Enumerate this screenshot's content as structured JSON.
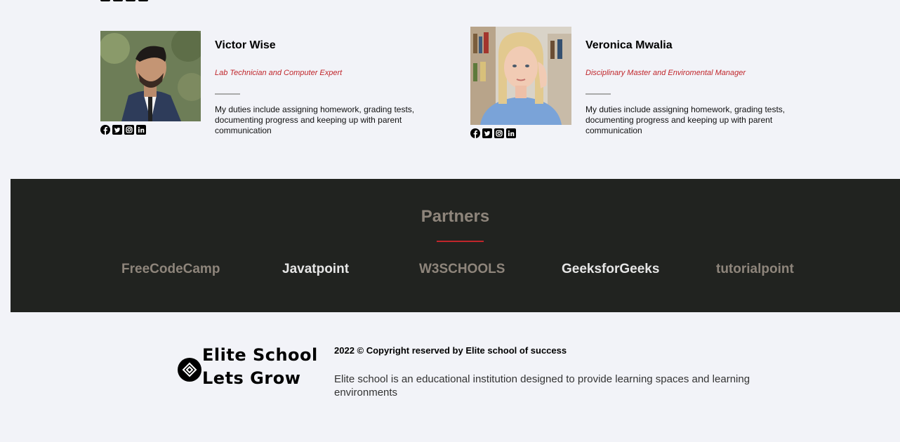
{
  "members": [
    {
      "name": "Victor Wise",
      "role": "Lab Technician and Computer Expert",
      "bio": "My duties include assigning homework, grading tests, documenting progress and keeping up with parent communication",
      "photo": "victor-photo",
      "socials": [
        "facebook-icon",
        "twitter-icon",
        "instagram-icon",
        "linkedin-icon"
      ]
    },
    {
      "name": "Veronica Mwalia",
      "role": "Disciplinary Master and Enviromental Manager",
      "bio": "My duties include assigning homework, grading tests, documenting progress and keeping up with parent communication",
      "photo": "veronica-photo",
      "socials": [
        "facebook-icon",
        "twitter-icon",
        "instagram-icon",
        "linkedin-icon"
      ]
    }
  ],
  "partners": {
    "title": "Partners",
    "links": [
      {
        "label": "FreeCodeCamp",
        "color": "#8e857b"
      },
      {
        "label": "Javatpoint",
        "color": "#e6e6e6"
      },
      {
        "label": "W3SCHOOLS",
        "color": "#8e857b"
      },
      {
        "label": "GeeksforGeeks",
        "color": "#e6e6e6"
      },
      {
        "label": "tutorialpoint",
        "color": "#8e857b"
      }
    ]
  },
  "footer": {
    "logo_line1": "Elite School",
    "logo_line2": "Lets Grow",
    "copyright": "2022 © Copyright reserved by Elite school of success",
    "description": "Elite school is an educational institution designed to provide learning spaces and learning environments"
  },
  "colors": {
    "accent": "#c0262b",
    "partners_bg": "#212320",
    "page_bg": "#f2f3f8"
  }
}
